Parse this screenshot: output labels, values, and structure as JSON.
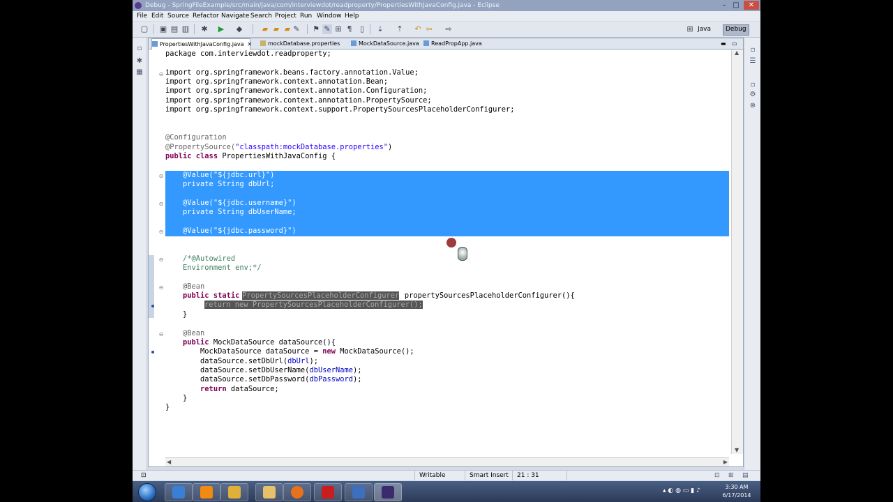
{
  "window": {
    "title": "Debug - SpringFileExample/src/main/java/com/interviewdot/readproperty/PropertiesWithJavaConfig.java - Eclipse"
  },
  "menu": [
    "File",
    "Edit",
    "Source",
    "Refactor",
    "Navigate",
    "Search",
    "Project",
    "Run",
    "Window",
    "Help"
  ],
  "perspectives": {
    "java": "Java",
    "debug": "Debug",
    "active": "Debug"
  },
  "tabs": [
    {
      "label": "PropertiesWithJavaConfig.java",
      "active": true
    },
    {
      "label": "mockDatabase.properties",
      "active": false
    },
    {
      "label": "MockDataSource.java",
      "active": false
    },
    {
      "label": "ReadPropApp.java",
      "active": false
    }
  ],
  "code": {
    "l1": "package com.interviewdot.readproperty;",
    "l3": "import org.springframework.beans.factory.annotation.Value;",
    "l4": "import org.springframework.context.annotation.Bean;",
    "l5": "import org.springframework.context.annotation.Configuration;",
    "l6": "import org.springframework.context.annotation.PropertySource;",
    "l7": "import org.springframework.context.support.PropertySourcesPlaceholderConfigurer;",
    "l10": "@Configuration",
    "l11a": "@PropertySource(",
    "l11b": "\"classpath:mockDatabase.properties\"",
    "l11c": ")",
    "l12a": "public class",
    "l12b": " PropertiesWithJavaConfig {",
    "l14": "    @Value(\"${jdbc.url}\")",
    "l15": "    private String dbUrl;",
    "l17": "    @Value(\"${jdbc.username}\")",
    "l18": "    private String dbUserName;",
    "l20": "    @Value(\"${jdbc.password}\")",
    "l21": "    private String dbPassword;",
    "l23": "    /*@Autowired",
    "l24": "    Environment env;*/",
    "l26": "    @Bean",
    "l27a": "    public static",
    "l27b": "PropertySourcesPlaceholderConfigurer",
    "l27c": " propertySourcesPlaceholderConfigurer(){",
    "l28": "return new PropertySourcesPlaceholderConfigurer();",
    "l29": "    }",
    "l31": "    @Bean",
    "l32a": "    public",
    "l32b": " MockDataSource dataSource(){",
    "l33a": "        MockDataSource dataSource = ",
    "l33b": "new",
    "l33c": " MockDataSource();",
    "l34a": "        dataSource.setDbUrl(",
    "l34b": "dbUrl",
    "l34c": ");",
    "l35a": "        dataSource.setDbUserName(",
    "l35b": "dbUserName",
    "l35c": ");",
    "l36a": "        dataSource.setDbPassword(",
    "l36b": "dbPassword",
    "l36c": ");",
    "l37a": "        ",
    "l37b": "return",
    "l37c": " dataSource;",
    "l38": "    }",
    "l39": "}"
  },
  "status": {
    "writable": "Writable",
    "insert_mode": "Smart Insert",
    "position": "21 : 31"
  },
  "taskbar": {
    "time": "3:30 AM",
    "date": "6/17/2014"
  },
  "colors": {
    "selection": "#3399ff",
    "keyword": "#7f0055",
    "string": "#2a00ff",
    "comment": "#3f7f5f",
    "field": "#0000c0"
  }
}
